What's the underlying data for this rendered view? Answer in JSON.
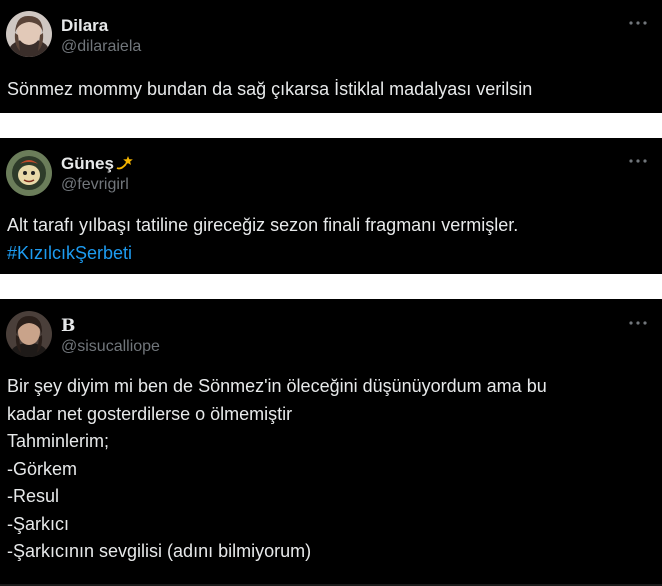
{
  "tweets": [
    {
      "name": "Dilara",
      "handle": "@dilaraiela",
      "text": "Sönmez mommy bundan da sağ çıkarsa İstiklal madalyası verilsin"
    },
    {
      "name": "Güneş",
      "name_emoji": "dizzy-star-icon",
      "handle": "@fevrigirl",
      "text": "Alt tarafı yılbaşı tatiline gireceğiz sezon finali fragmanı vermişler.",
      "hashtag": "#KızılcıkŞerbeti"
    },
    {
      "name": "B",
      "handle": "@sisucalliope",
      "lines": [
        "Bir şey diyim mi ben de Sönmez'in öleceğini düşünüyordum ama bu",
        "kadar net gosterdilerse o ölmemiştir",
        "Tahminlerim;",
        "-Görkem",
        "-Resul",
        "-Şarkıcı",
        "-Şarkıcının sevgilisi (adını bilmiyorum)"
      ]
    }
  ],
  "colors": {
    "background": "#000000",
    "text": "#e7e9ea",
    "secondary": "#71767b",
    "link": "#1d9bf0",
    "separator": "#ffffff"
  }
}
